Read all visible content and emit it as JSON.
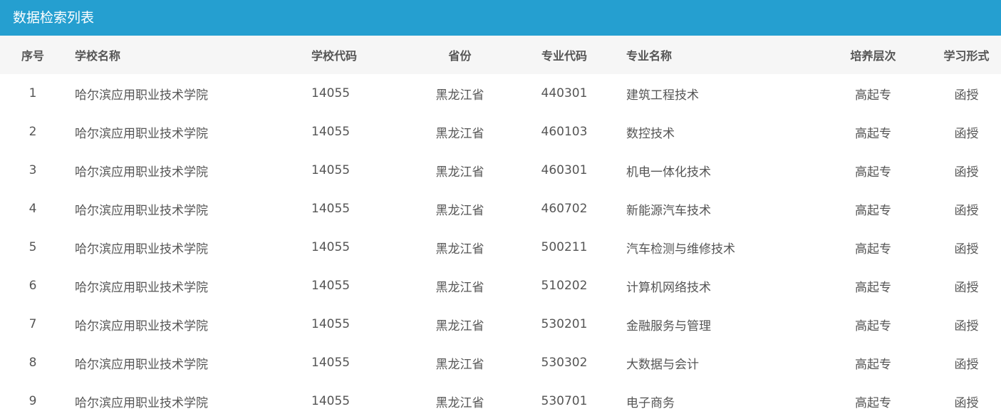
{
  "panel": {
    "title": "数据检索列表"
  },
  "table": {
    "headers": [
      "序号",
      "学校名称",
      "学校代码",
      "省份",
      "专业代码",
      "专业名称",
      "培养层次",
      "学习形式"
    ],
    "rows": [
      [
        "1",
        "哈尔滨应用职业技术学院",
        "14055",
        "黑龙江省",
        "440301",
        "建筑工程技术",
        "高起专",
        "函授"
      ],
      [
        "2",
        "哈尔滨应用职业技术学院",
        "14055",
        "黑龙江省",
        "460103",
        "数控技术",
        "高起专",
        "函授"
      ],
      [
        "3",
        "哈尔滨应用职业技术学院",
        "14055",
        "黑龙江省",
        "460301",
        "机电一体化技术",
        "高起专",
        "函授"
      ],
      [
        "4",
        "哈尔滨应用职业技术学院",
        "14055",
        "黑龙江省",
        "460702",
        "新能源汽车技术",
        "高起专",
        "函授"
      ],
      [
        "5",
        "哈尔滨应用职业技术学院",
        "14055",
        "黑龙江省",
        "500211",
        "汽车检测与维修技术",
        "高起专",
        "函授"
      ],
      [
        "6",
        "哈尔滨应用职业技术学院",
        "14055",
        "黑龙江省",
        "510202",
        "计算机网络技术",
        "高起专",
        "函授"
      ],
      [
        "7",
        "哈尔滨应用职业技术学院",
        "14055",
        "黑龙江省",
        "530201",
        "金融服务与管理",
        "高起专",
        "函授"
      ],
      [
        "8",
        "哈尔滨应用职业技术学院",
        "14055",
        "黑龙江省",
        "530302",
        "大数据与会计",
        "高起专",
        "函授"
      ],
      [
        "9",
        "哈尔滨应用职业技术学院",
        "14055",
        "黑龙江省",
        "530701",
        "电子商务",
        "高起专",
        "函授"
      ]
    ]
  },
  "colors": {
    "header_bar": "#259fd0",
    "header_text": "#ffffff",
    "table_head_bg": "#f6f6f6",
    "text": "#555555"
  }
}
